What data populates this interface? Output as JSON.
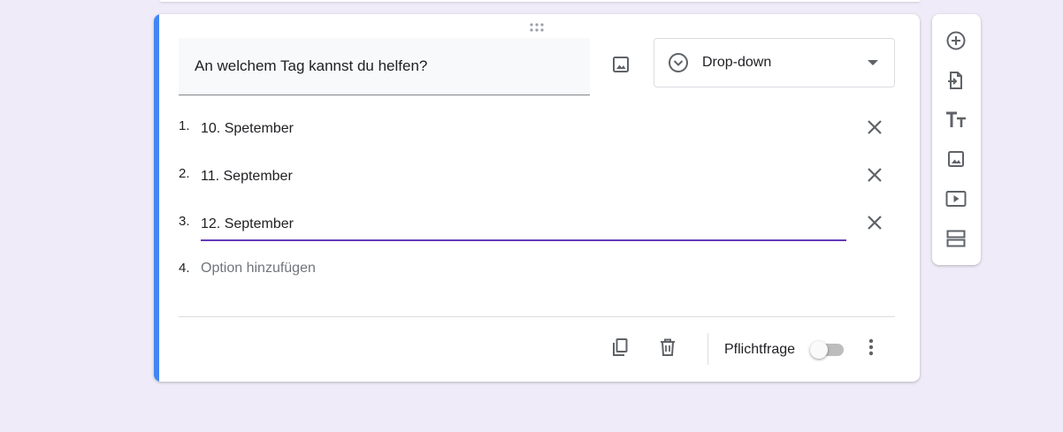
{
  "question": {
    "title": "An welchem Tag kannst du helfen?",
    "type_label": "Drop-down"
  },
  "options": [
    {
      "number": "1.",
      "text": "10. Spetember"
    },
    {
      "number": "2.",
      "text": "11. September"
    },
    {
      "number": "3.",
      "text": "12. September"
    }
  ],
  "add_option": {
    "number": "4.",
    "placeholder": "Option hinzufügen"
  },
  "footer": {
    "required_label": "Pflichtfrage",
    "required_on": false
  },
  "colors": {
    "accent": "#4285f4",
    "active_underline": "#673ab7",
    "background": "#efebf8"
  },
  "icons": {
    "drag": "drag-handle-icon",
    "image": "image-icon",
    "type": "dropdown-circle-icon",
    "remove": "close-icon",
    "duplicate": "copy-icon",
    "delete": "trash-icon",
    "more": "more-vert-icon",
    "toolbar": [
      "add-circle-icon",
      "import-icon",
      "title-text-icon",
      "image-icon",
      "video-icon",
      "section-icon"
    ]
  }
}
